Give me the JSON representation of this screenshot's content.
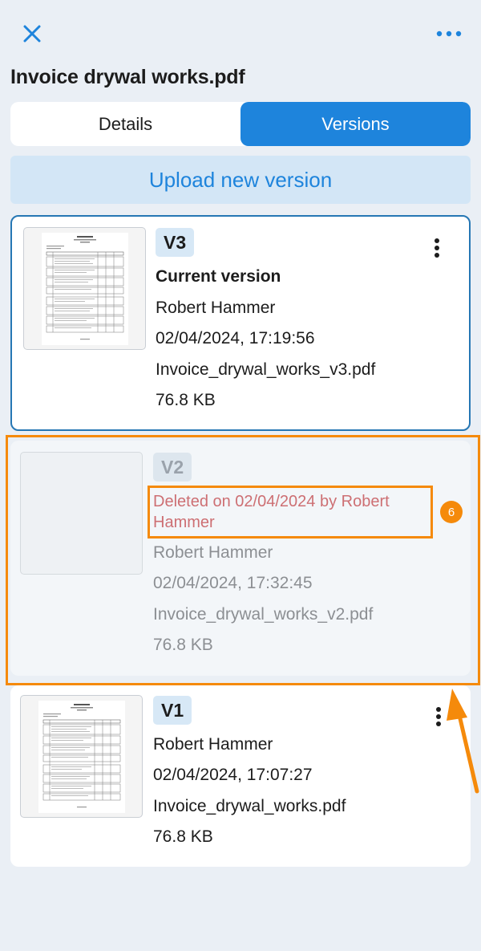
{
  "header": {
    "close_icon": "close-icon",
    "more_icon": "more-horizontal-icon",
    "title": "Invoice drywal works.pdf"
  },
  "tabs": [
    {
      "label": "Details",
      "active": false
    },
    {
      "label": "Versions",
      "active": true
    }
  ],
  "upload_button": "Upload new version",
  "versions": [
    {
      "badge": "V3",
      "current_label": "Current version",
      "author": "Robert Hammer",
      "timestamp": "02/04/2024, 17:19:56",
      "filename": "Invoice_drywal_works_v3.pdf",
      "size": "76.8 KB"
    },
    {
      "badge": "V2",
      "deleted_note": "Deleted on 02/04/2024 by Robert Hammer",
      "author": "Robert Hammer",
      "timestamp": "02/04/2024, 17:32:45",
      "filename": "Invoice_drywal_works_v2.pdf",
      "size": "76.8 KB"
    },
    {
      "badge": "V1",
      "author": "Robert Hammer",
      "timestamp": "02/04/2024, 17:07:27",
      "filename": "Invoice_drywal_works.pdf",
      "size": "76.8 KB"
    }
  ],
  "annotation": {
    "step_number": "6",
    "color": "#f58a0b"
  },
  "colors": {
    "accent": "#1e84dc",
    "background": "#eaeff5",
    "deleted_text": "#cd6f73"
  }
}
